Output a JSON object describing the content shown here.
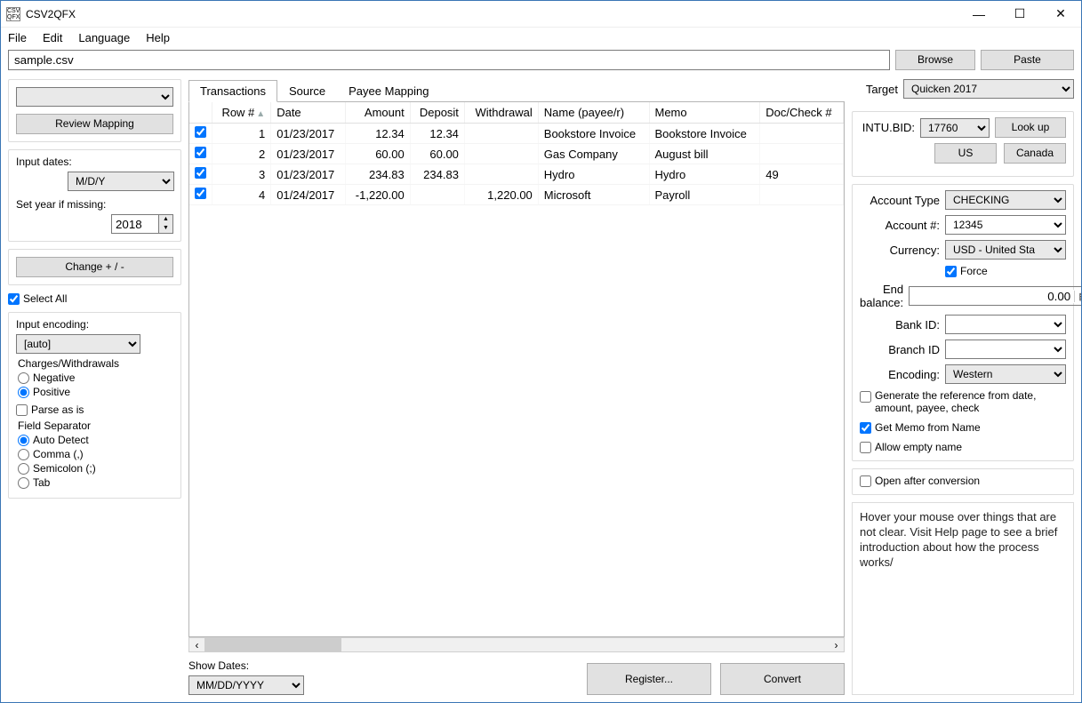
{
  "window": {
    "title": "CSV2QFX"
  },
  "menu": {
    "file": "File",
    "edit": "Edit",
    "language": "Language",
    "help": "Help"
  },
  "fileRow": {
    "path": "sample.csv",
    "browse": "Browse",
    "paste": "Paste"
  },
  "left": {
    "review": "Review Mapping",
    "inputDates": {
      "label": "Input dates:",
      "value": "M/D/Y"
    },
    "setYear": {
      "label": "Set year if missing:",
      "value": "2018"
    },
    "change": "Change + / -",
    "selectAll": "Select All",
    "encoding": {
      "label": "Input encoding:",
      "value": "[auto]"
    },
    "charges": {
      "title": "Charges/Withdrawals",
      "neg": "Negative",
      "pos": "Positive"
    },
    "parseAsIs": "Parse as is",
    "sep": {
      "title": "Field Separator",
      "auto": "Auto Detect",
      "comma": "Comma (,)",
      "semi": "Semicolon (;)",
      "tab": "Tab"
    }
  },
  "tabs": {
    "transactions": "Transactions",
    "source": "Source",
    "payee": "Payee Mapping"
  },
  "grid": {
    "headers": {
      "row": "Row #",
      "date": "Date",
      "amount": "Amount",
      "deposit": "Deposit",
      "withdrawal": "Withdrawal",
      "name": "Name (payee/r)",
      "memo": "Memo",
      "doc": "Doc/Check #"
    },
    "rows": [
      {
        "row": "1",
        "date": "01/23/2017",
        "amount": "12.34",
        "deposit": "12.34",
        "withdrawal": "",
        "name": "Bookstore Invoice",
        "memo": "Bookstore Invoice",
        "doc": ""
      },
      {
        "row": "2",
        "date": "01/23/2017",
        "amount": "60.00",
        "deposit": "60.00",
        "withdrawal": "",
        "name": "Gas Company",
        "memo": "August bill",
        "doc": ""
      },
      {
        "row": "3",
        "date": "01/23/2017",
        "amount": "234.83",
        "deposit": "234.83",
        "withdrawal": "",
        "name": "Hydro",
        "memo": "Hydro",
        "doc": "49"
      },
      {
        "row": "4",
        "date": "01/24/2017",
        "amount": "-1,220.00",
        "deposit": "",
        "withdrawal": "1,220.00",
        "name": "Microsoft",
        "memo": "Payroll",
        "doc": ""
      }
    ]
  },
  "bottom": {
    "showDates": "Show Dates:",
    "dateFmt": "MM/DD/YYYY",
    "register": "Register...",
    "convert": "Convert"
  },
  "right": {
    "target": {
      "label": "Target",
      "value": "Quicken 2017"
    },
    "intubid": {
      "label": "INTU.BID:",
      "value": "17760",
      "lookup": "Look up"
    },
    "us": "US",
    "canada": "Canada",
    "accountType": {
      "label": "Account Type",
      "value": "CHECKING"
    },
    "accountNum": {
      "label": "Account #:",
      "value": "12345"
    },
    "currency": {
      "label": "Currency:",
      "value": "USD - United Sta"
    },
    "force": "Force",
    "endBalance": {
      "label": "End balance:",
      "value": "0.00"
    },
    "bankId": {
      "label": "Bank ID:",
      "value": ""
    },
    "branchId": {
      "label": "Branch ID",
      "value": ""
    },
    "encoding": {
      "label": "Encoding:",
      "value": "Western"
    },
    "genRef": "Generate the reference from date, amount, payee, check",
    "getMemo": "Get Memo from Name",
    "allowEmpty": "Allow empty name",
    "openAfter": "Open after conversion",
    "help": "Hover your mouse over things that are not clear. Visit Help page to see a brief introduction about how the process works/"
  }
}
